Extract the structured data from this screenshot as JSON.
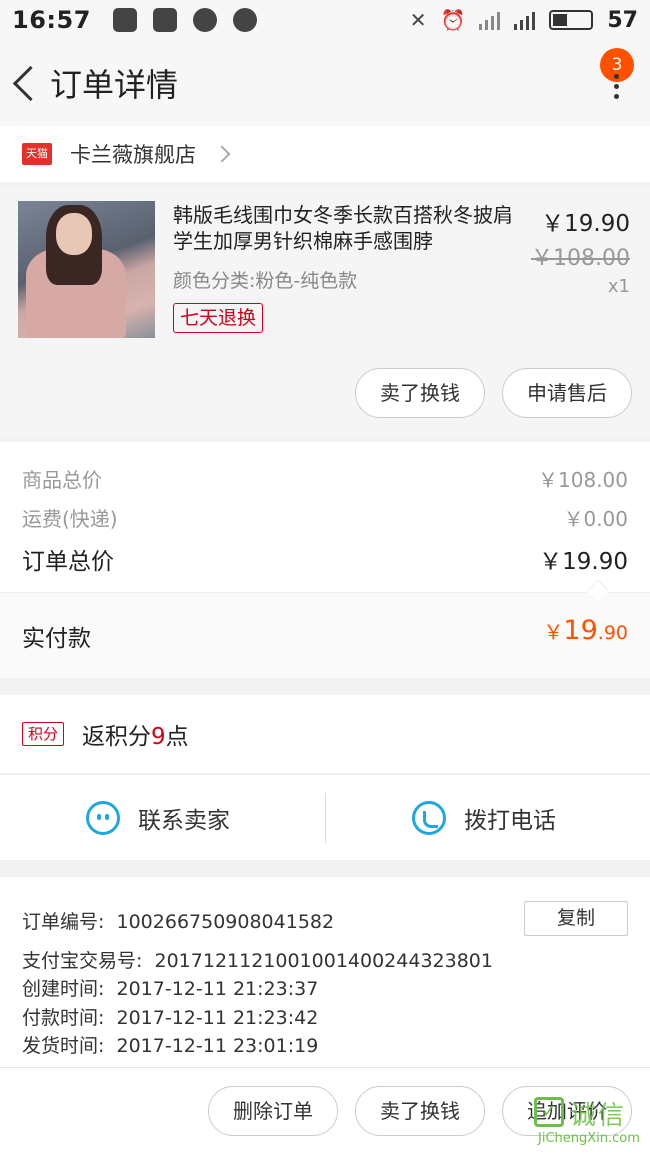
{
  "status_bar": {
    "time": "16:57",
    "battery": "57"
  },
  "header": {
    "title": "订单详情",
    "badge_count": "3"
  },
  "shop": {
    "tmall_label": "天猫",
    "name": "卡兰薇旗舰店"
  },
  "product": {
    "title": "韩版毛线围巾女冬季长款百搭秋冬披肩学生加厚男针织棉麻手感围脖",
    "sku": "颜色分类:粉色-纯色款",
    "tag": "七天退换",
    "price": "￥19.90",
    "original_price": "￥108.00",
    "quantity": "x1",
    "buttons": {
      "sell": "卖了换钱",
      "after_sale": "申请售后"
    }
  },
  "summary": {
    "goods_total_label": "商品总价",
    "goods_total_value": "￥108.00",
    "shipping_label": "运费(快递)",
    "shipping_value": "￥0.00",
    "order_total_label": "订单总价",
    "order_total_value": "￥19.90",
    "paid_label": "实付款",
    "paid_currency": "￥",
    "paid_int": "19",
    "paid_dec": ".90"
  },
  "points": {
    "tag": "积分",
    "prefix": "返积分",
    "count": "9",
    "suffix": "点"
  },
  "contact": {
    "seller": "联系卖家",
    "phone": "拨打电话"
  },
  "order_info": {
    "order_no_label": "订单编号:",
    "order_no": "100266750908041582",
    "copy": "复制",
    "alipay_label": "支付宝交易号:",
    "alipay_no": "2017121121001001400244323801",
    "created_label": "创建时间:",
    "created": "2017-12-11 21:23:37",
    "paid_label": "付款时间:",
    "paid": "2017-12-11 21:23:42",
    "shipped_label": "发货时间:",
    "shipped": "2017-12-11 23:01:19"
  },
  "bottom_bar": {
    "delete": "删除订单",
    "sell": "卖了换钱",
    "review": "追加评价"
  },
  "watermark": {
    "cn": "诚信",
    "en": "JiChengXin.com"
  },
  "colors": {
    "accent": "#ff5000",
    "tmall_red": "#e4302b",
    "tag_red": "#d0021b",
    "contact_blue": "#1ea7e1"
  }
}
